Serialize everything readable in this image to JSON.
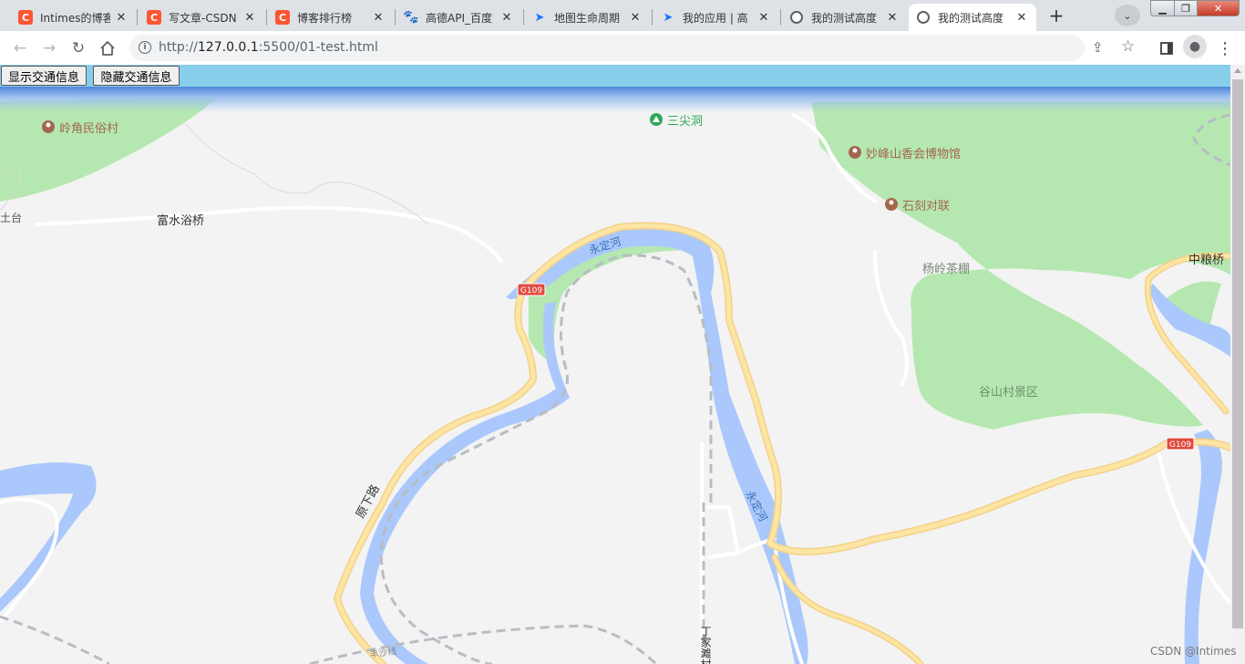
{
  "browser": {
    "tabs": [
      {
        "title": "Intimes的博客",
        "icon": "csdn-icon",
        "active": false
      },
      {
        "title": "写文章-CSDN",
        "icon": "csdn-icon",
        "active": false
      },
      {
        "title": "博客排行榜",
        "icon": "csdn-icon",
        "active": false
      },
      {
        "title": "高德API_百度",
        "icon": "baidu-paw-icon",
        "active": false
      },
      {
        "title": "地图生命周期",
        "icon": "amap-arrow-icon",
        "active": false
      },
      {
        "title": "我的应用 | 高",
        "icon": "amap-arrow-icon",
        "active": false
      },
      {
        "title": "我的测试高度",
        "icon": "globe-icon",
        "active": false
      },
      {
        "title": "我的测试高度",
        "icon": "globe-icon",
        "active": true
      }
    ],
    "url": "http://127.0.0.1:5500/01-test.html",
    "url_host": "127.0.0.1",
    "url_rest": ":5500/01-test.html",
    "url_scheme": "http://"
  },
  "page": {
    "buttons": {
      "show_traffic": "显示交通信息",
      "hide_traffic": "隐藏交通信息"
    },
    "button_bar_color": "#87ceeb",
    "watermark": "CSDN @Intimes"
  },
  "map": {
    "colors": {
      "land": "#f3f3f3",
      "green": "#b5e8b0",
      "water": "#aac8fb",
      "main_road": "#fde5a4",
      "road_edge": "#f3d188",
      "minor_road": "#ffffff",
      "rail": "#b8bcc4",
      "poi_brown": "#a3674e",
      "poi_green": "#2fa85a"
    },
    "labels": {
      "lingjiao": "岭角民俗村",
      "sanjiandong": "三尖洞",
      "miaofengshan": "妙峰山香会博物馆",
      "shikeduilian": "石刻对联",
      "yanglingchapeng": "杨岭茶棚",
      "zhongliangqiao": "中粮桥",
      "fushuiyuqiao": "富水浴桥",
      "tutai": "土台",
      "gushancun": "谷山村景区",
      "yongdinghe1": "永定河",
      "yongdinghe2": "永定河",
      "g109_1": "G109",
      "g109_2": "G109",
      "yuanxialu": "原下路",
      "dingjiatancun": "丁家滩村",
      "fengshaxian": "丰沙线"
    }
  }
}
